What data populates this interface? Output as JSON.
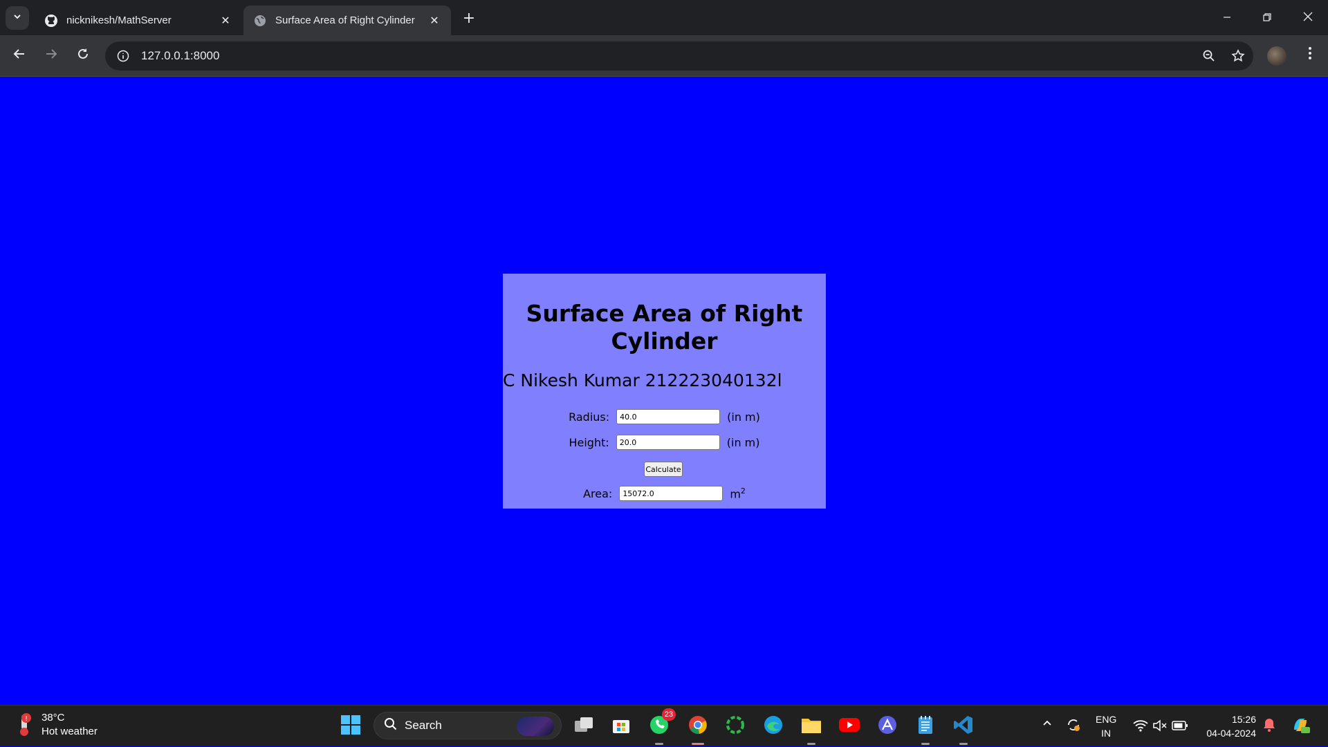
{
  "browser": {
    "tabs": [
      {
        "title": "nicknikesh/MathServer",
        "icon": "github-icon",
        "active": false
      },
      {
        "title": "Surface Area of Right Cylinder",
        "icon": "globe-icon",
        "active": true
      }
    ],
    "url": "127.0.0.1:8000"
  },
  "page": {
    "background_color": "#0000ff",
    "card_color": "#8080ff",
    "heading": "Surface Area of Right Cylinder",
    "author": "C Nikesh Kumar 212223040132l",
    "radius": {
      "label": "Radius:",
      "value": "40.0",
      "unit": "(in m)"
    },
    "height": {
      "label": "Height:",
      "value": "20.0",
      "unit": "(in m)"
    },
    "calculate_label": "Calculate",
    "area": {
      "label": "Area:",
      "value": "15072.0",
      "unit_base": "m",
      "unit_exp": "2"
    }
  },
  "taskbar": {
    "weather": {
      "temp": "38°C",
      "desc": "Hot weather"
    },
    "search_placeholder": "Search",
    "whatsapp_badge": "23",
    "language": {
      "line1": "ENG",
      "line2": "IN"
    },
    "clock": {
      "time": "15:26",
      "date": "04-04-2024"
    }
  }
}
